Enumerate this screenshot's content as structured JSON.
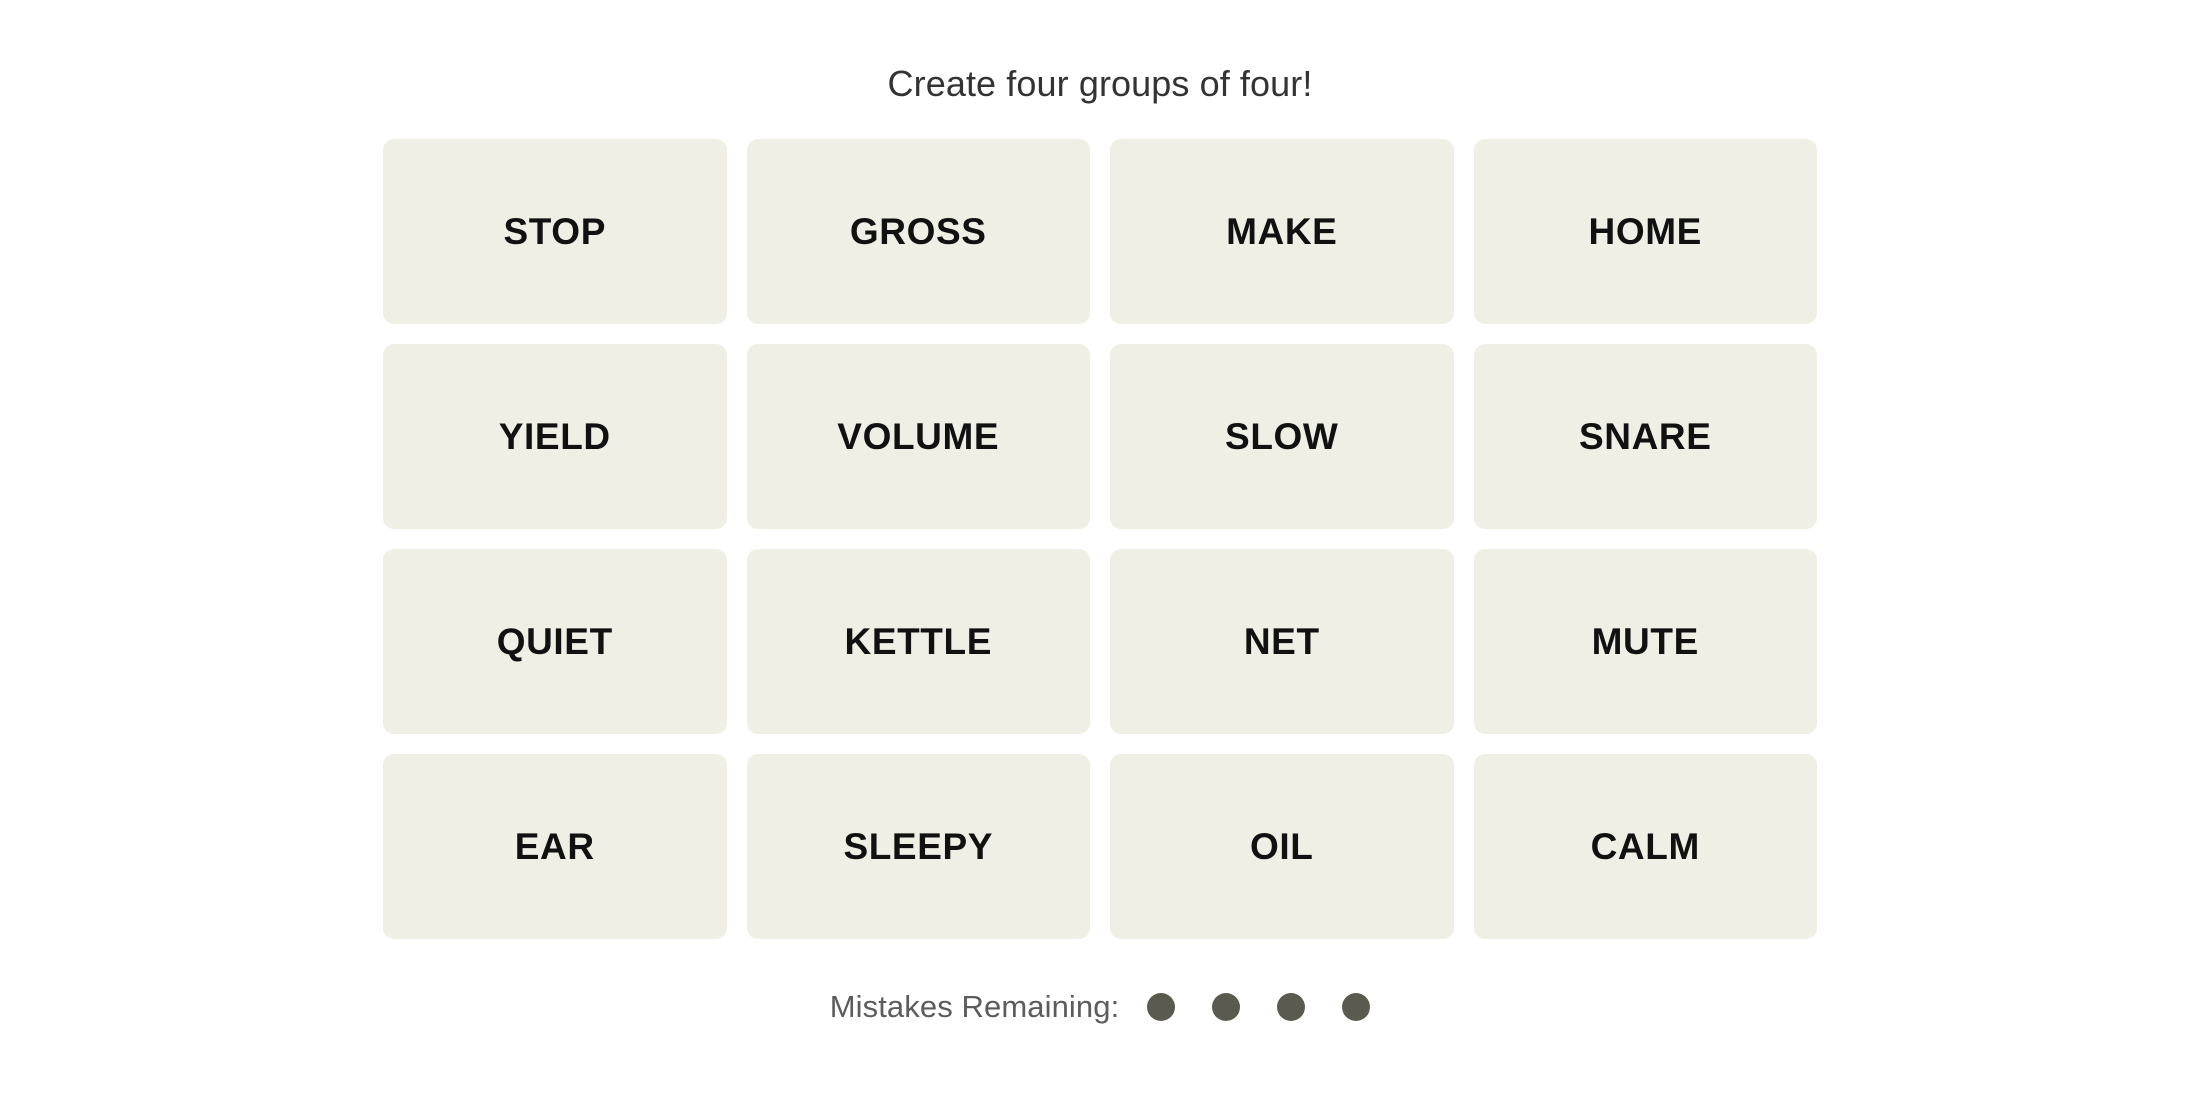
{
  "header": {
    "instruction": "Create four groups of four!"
  },
  "board": {
    "rows": 4,
    "columns": 4,
    "tile_color": "#efefe6",
    "tile_text_color": "#111111",
    "tiles": [
      {
        "label": "STOP"
      },
      {
        "label": "GROSS"
      },
      {
        "label": "MAKE"
      },
      {
        "label": "HOME"
      },
      {
        "label": "YIELD"
      },
      {
        "label": "VOLUME"
      },
      {
        "label": "SLOW"
      },
      {
        "label": "SNARE"
      },
      {
        "label": "QUIET"
      },
      {
        "label": "KETTLE"
      },
      {
        "label": "NET"
      },
      {
        "label": "MUTE"
      },
      {
        "label": "EAR"
      },
      {
        "label": "SLEEPY"
      },
      {
        "label": "OIL"
      },
      {
        "label": "CALM"
      }
    ]
  },
  "footer": {
    "mistakes_label": "Mistakes Remaining:",
    "mistakes_remaining": 4,
    "dot_color": "#5a5a4e",
    "dots": [
      {
        "name": "mistake-dot-1"
      },
      {
        "name": "mistake-dot-2"
      },
      {
        "name": "mistake-dot-3"
      },
      {
        "name": "mistake-dot-4"
      }
    ]
  },
  "theme": {
    "page_background": "#ffffff",
    "title_color": "#333333",
    "label_color": "#5c5c5c"
  }
}
